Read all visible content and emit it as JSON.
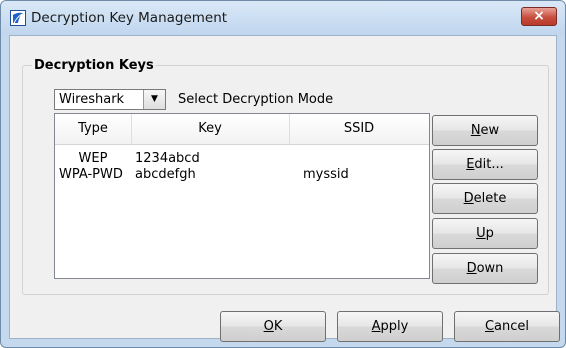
{
  "window": {
    "title": "Decryption Key Management",
    "close_label": "×",
    "icon": "wireshark-fin-icon"
  },
  "group": {
    "label": "Decryption Keys"
  },
  "mode": {
    "selected": "Wireshark",
    "label": "Select Decryption Mode"
  },
  "table": {
    "columns": [
      "Type",
      "Key",
      "SSID"
    ],
    "rows": [
      {
        "type": "WEP",
        "key": "1234abcd",
        "ssid": ""
      },
      {
        "type": "WPA-PWD",
        "key": "abcdefgh",
        "ssid": "myssid"
      }
    ]
  },
  "side_buttons": {
    "new": {
      "first": "N",
      "rest": "ew"
    },
    "edit": {
      "first": "E",
      "rest": "dit..."
    },
    "delete": {
      "first": "D",
      "rest": "elete"
    },
    "up": {
      "first": "U",
      "rest": "p"
    },
    "down": {
      "first": "D",
      "rest": "own"
    }
  },
  "footer_buttons": {
    "ok": {
      "first": "O",
      "rest": "K"
    },
    "apply": {
      "first": "A",
      "rest": "pply"
    },
    "cancel": {
      "first": "C",
      "rest": "ancel"
    }
  },
  "colors": {
    "frame": "#c5d9ee",
    "close_button": "#c74e3e",
    "client_background": "#f0f0f0"
  }
}
